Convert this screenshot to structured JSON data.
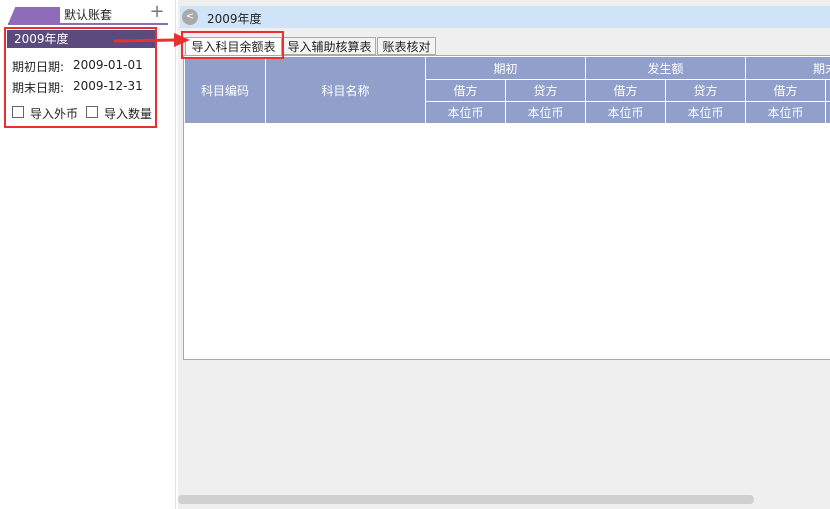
{
  "sidebar": {
    "ledger_tab": "默认账套",
    "add_icon": "+",
    "year_header": "2009年度",
    "start_date_label": "期初日期:",
    "start_date_value": "2009-01-01",
    "end_date_label": "期末日期:",
    "end_date_value": "2009-12-31",
    "import_foreign_label": "导入外币",
    "import_quantity_label": "导入数量"
  },
  "header": {
    "back_label": "<",
    "title": "2009年度"
  },
  "tabs": [
    {
      "label": "导入科目余额表",
      "active": true
    },
    {
      "label": "导入辅助核算表",
      "active": false
    },
    {
      "label": "账表核对",
      "active": false
    }
  ],
  "table": {
    "col_code": "科目编码",
    "col_name": "科目名称",
    "group_opening": "期初",
    "group_amount": "发生额",
    "group_end_partial": "期末",
    "debit": "借方",
    "credit": "贷方",
    "local_currency": "本位币"
  },
  "colors": {
    "accent_purple": "#8e6bb8",
    "year_header_bg": "#5b4b7d",
    "grid_header_bg": "#919fcb",
    "highlight_red": "#e8302f",
    "title_bar_bg": "#cfe4f7"
  }
}
